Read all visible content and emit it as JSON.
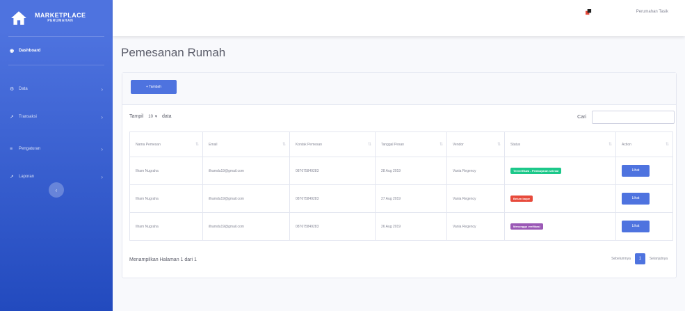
{
  "brand": {
    "title": "MARKETPLACE",
    "subtitle": "PERUMAHAN",
    "icon": "house-icon"
  },
  "sidebar": {
    "dashboard": "Dashboard",
    "items": [
      {
        "label": "Data",
        "icon": "cog-icon"
      },
      {
        "label": "Transaksi",
        "icon": "chart-line-icon"
      },
      {
        "label": "Pengaturan",
        "icon": "sliders-icon"
      },
      {
        "label": "Laporan",
        "icon": "chart-line-icon"
      }
    ],
    "toggle": "‹"
  },
  "topbar": {
    "user_name": "Perumahan Tasik"
  },
  "page": {
    "title": "Pemesanan Rumah"
  },
  "card": {
    "add_button": "+ Tambah"
  },
  "table_controls": {
    "show_label": "Tampil",
    "length_value": "10",
    "entries_label": "data",
    "search_label": "Cari"
  },
  "table": {
    "headers": [
      "Nama Pemesan",
      "Email",
      "Kontak Pemesan",
      "Tanggal Pesan",
      "Vendor",
      "Status",
      "Action"
    ],
    "rows": [
      {
        "nama": "Ilham Nugraha",
        "email": "ilhamdu19@gmail.com",
        "kontak": "087675849283",
        "tanggal": "28 Aug 2019",
        "vendor": "Vania Regency",
        "status": "Terverifikasi - Pembayaran selesai",
        "status_color": "#1cc88a",
        "action": "Lihat"
      },
      {
        "nama": "Ilham Nugraha",
        "email": "ilhamdu19@gmail.com",
        "kontak": "087675849283",
        "tanggal": "27 Aug 2019",
        "vendor": "Vania Regency",
        "status": "Belum bayar",
        "status_color": "#e74a3b",
        "action": "Lihat"
      },
      {
        "nama": "Ilham Nugraha",
        "email": "ilhamdu19@gmail.com",
        "kontak": "087675849283",
        "tanggal": "26 Aug 2019",
        "vendor": "Vania Regency",
        "status": "Menunggu verifikasi",
        "status_color": "#9b59b6",
        "action": "Lihat"
      }
    ]
  },
  "footer": {
    "info": "Menampilkan Halaman 1 dari 1",
    "prev": "Sebelumnya",
    "page": "1",
    "next": "Selanjutnya"
  },
  "colors": {
    "primary": "#4e73df",
    "success": "#1cc88a",
    "danger": "#e74a3b",
    "purple": "#9b59b6"
  }
}
